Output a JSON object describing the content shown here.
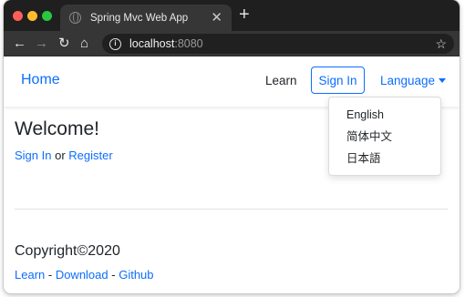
{
  "browser": {
    "tab_title": "Spring Mvc Web App",
    "tab_close": "✕",
    "new_tab": "+",
    "url_host": "localhost",
    "url_port": ":8080",
    "icons": [
      "globe-icon",
      "back-icon",
      "forward-icon",
      "reload-icon",
      "home-icon",
      "info-icon",
      "star-icon"
    ]
  },
  "navbar": {
    "brand": "Home",
    "learn": "Learn",
    "sign_in": "Sign In",
    "language": "Language"
  },
  "language_menu": [
    "English",
    "简体中文",
    "日本語"
  ],
  "main": {
    "welcome": "Welcome!",
    "sign_in_link": "Sign In",
    "or": " or ",
    "register_link": "Register"
  },
  "footer": {
    "copyright": "Copyright©2020",
    "links": [
      "Learn",
      "Download",
      "Github"
    ],
    "separator": " - "
  },
  "colors": {
    "link": "#0d6efd",
    "text": "#212529",
    "chrome_dark": "#1f1f1f",
    "chrome_toolbar": "#363636"
  }
}
